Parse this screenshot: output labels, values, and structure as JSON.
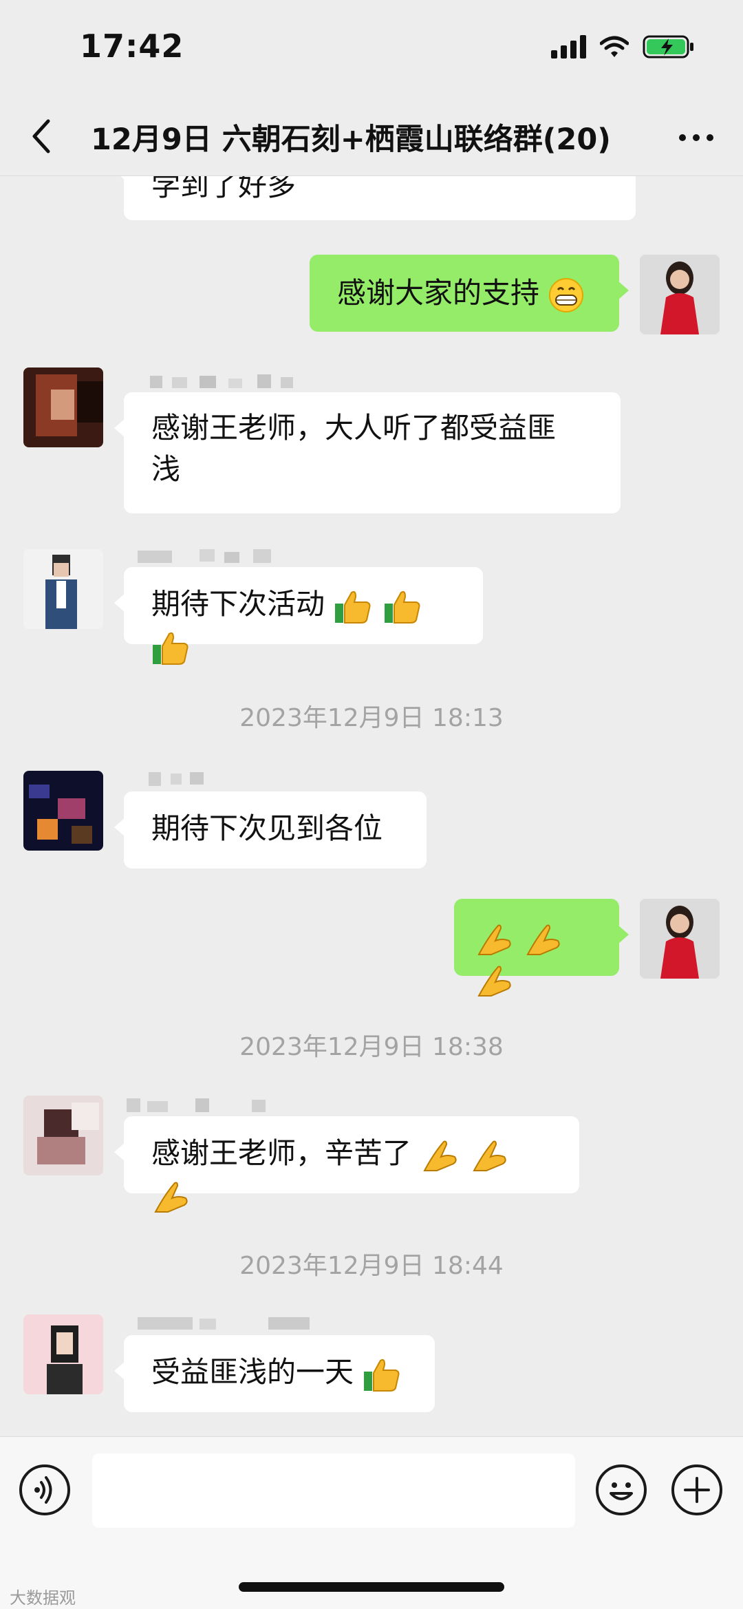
{
  "status_bar": {
    "time": "17:42"
  },
  "nav": {
    "title": "12月9日 六朝石刻+栖霞山联络群(20)"
  },
  "messages": {
    "m0": {
      "text": "学到了好多"
    },
    "m1": {
      "text": "感谢大家的支持"
    },
    "m2": {
      "line1": "感谢王老师，大人听了都受益匪",
      "line2": "浅"
    },
    "m3": {
      "text": "期待下次活动"
    },
    "t1": {
      "text": "2023年12月9日 18:13"
    },
    "m4": {
      "text": "期待下次见到各位"
    },
    "t2": {
      "text": "2023年12月9日 18:38"
    },
    "m6": {
      "text": "感谢王老师，辛苦了"
    },
    "t3": {
      "text": "2023年12月9日 18:44"
    },
    "m7": {
      "text": "受益匪浅的一天"
    }
  },
  "icons": {
    "back": "chevron-left-icon",
    "more": "more-dots-icon",
    "voice": "voice-icon",
    "emoji": "emoji-icon",
    "plus": "plus-icon"
  },
  "colors": {
    "background": "#ededed",
    "sent_bubble": "#95ec69",
    "received_bubble": "#ffffff",
    "timestamp": "#a3a3a3"
  },
  "watermark": "大数据观"
}
